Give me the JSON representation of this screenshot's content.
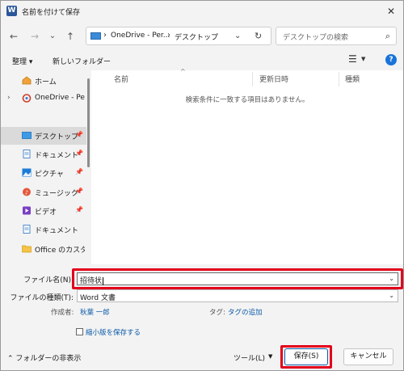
{
  "window": {
    "title": "名前を付けて保存",
    "app_icon_letter": "W",
    "close_glyph": "✕"
  },
  "nav": {
    "back_glyph": "←",
    "forward_glyph": "→",
    "recent_glyph": "⌄",
    "up_glyph": "↑",
    "breadcrumb": [
      "OneDrive - Per...",
      "デスクトップ"
    ],
    "sep_glyph": "›",
    "dropdown_glyph": "⌄",
    "refresh_glyph": "↻",
    "search_placeholder": "デスクトップの検索",
    "search_glyph": "⌕"
  },
  "toolbar": {
    "organize": "整理 ▾",
    "new_folder": "新しいフォルダー",
    "view_glyph": "☰",
    "view_dd_glyph": "▼",
    "help_glyph": "?"
  },
  "sidebar": {
    "items": [
      {
        "label": "ホーム",
        "icon": "home-icon",
        "expand": "",
        "pin": ""
      },
      {
        "label": "OneDrive - Perso",
        "icon": "onedrive-icon",
        "expand": "›",
        "pin": ""
      },
      {
        "label": "デスクトップ",
        "icon": "desktop-icon",
        "expand": "",
        "pin": "📌"
      },
      {
        "label": "ドキュメント",
        "icon": "documents-icon",
        "expand": "",
        "pin": "📌"
      },
      {
        "label": "ピクチャ",
        "icon": "pictures-icon",
        "expand": "",
        "pin": "📌"
      },
      {
        "label": "ミュージック",
        "icon": "music-icon",
        "expand": "",
        "pin": "📌"
      },
      {
        "label": "ビデオ",
        "icon": "video-icon",
        "expand": "",
        "pin": "📌"
      },
      {
        "label": "ドキュメント",
        "icon": "documents-icon",
        "expand": "",
        "pin": ""
      },
      {
        "label": "Office のカスタム",
        "icon": "folder-icon",
        "expand": "",
        "pin": ""
      }
    ],
    "selected_index": 2
  },
  "content": {
    "columns": [
      "名前",
      "更新日時",
      "種類"
    ],
    "sort_glyph": "^",
    "empty_message": "検索条件に一致する項目はありません。"
  },
  "form": {
    "filename_label": "ファイル名(N):",
    "filename_value": "招待状",
    "filetype_label": "ファイルの種類(T):",
    "filetype_value": "Word 文書",
    "dd_glyph": "⌄",
    "author_label": "作成者:",
    "author_value": "秋葉 一郎",
    "tags_label": "タグ:",
    "tags_value": "タグの追加",
    "thumbnail_label": "縮小版を保存する"
  },
  "footer": {
    "hide_folders": "⌃ フォルダーの非表示",
    "tools": "ツール(L)",
    "tools_dd": "▼",
    "save": "保存(S)",
    "cancel": "キャンセル"
  },
  "colors": {
    "highlight_frame": "#e3001b",
    "accent": "#0a5aa8"
  }
}
